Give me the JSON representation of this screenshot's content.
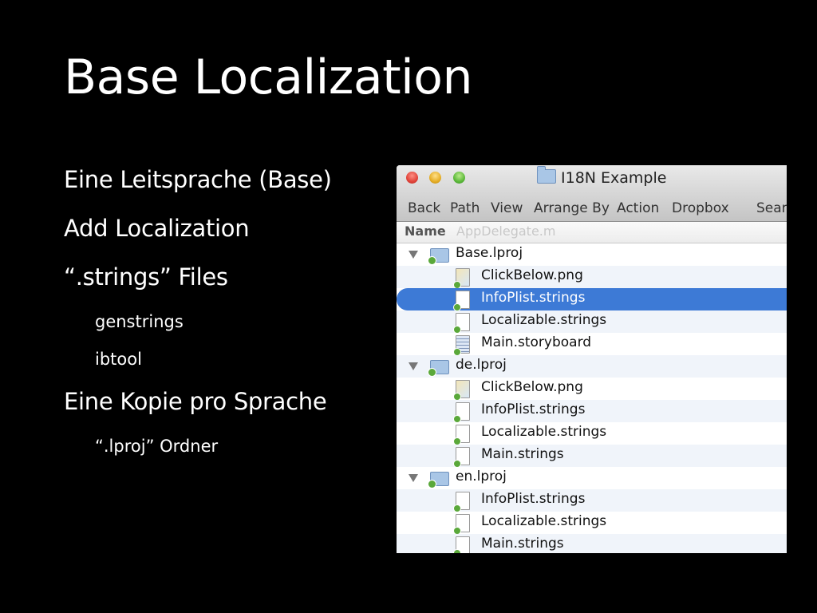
{
  "slide": {
    "title": "Base Localization",
    "bullets": [
      {
        "text": "Eine Leitsprache (Base)",
        "level": 1
      },
      {
        "text": "Add Localization",
        "level": 1
      },
      {
        "text": "“.strings” Files",
        "level": 1
      },
      {
        "text": "genstrings",
        "level": 2
      },
      {
        "text": "ibtool",
        "level": 2
      },
      {
        "text": "Eine Kopie pro Sprache",
        "level": 1
      },
      {
        "text": "“.lproj” Ordner",
        "level": 2
      }
    ]
  },
  "finder": {
    "window_title": "I18N Example",
    "toolbar": [
      "Back",
      "Path",
      "View",
      "Arrange By",
      "Action",
      "Dropbox",
      "Searc"
    ],
    "column_header": "Name",
    "column_header_faded": "AppDelegate.m",
    "rows": [
      {
        "label": "Base.lproj",
        "kind": "folder",
        "icon": "folder-icon"
      },
      {
        "label": "ClickBelow.png",
        "kind": "file",
        "icon": "image-file-icon"
      },
      {
        "label": "InfoPlist.strings",
        "kind": "file",
        "icon": "document-icon",
        "selected": true
      },
      {
        "label": "Localizable.strings",
        "kind": "file",
        "icon": "document-icon"
      },
      {
        "label": "Main.storyboard",
        "kind": "file",
        "icon": "storyboard-icon"
      },
      {
        "label": "de.lproj",
        "kind": "folder",
        "icon": "folder-icon"
      },
      {
        "label": "ClickBelow.png",
        "kind": "file",
        "icon": "image-file-icon"
      },
      {
        "label": "InfoPlist.strings",
        "kind": "file",
        "icon": "document-icon"
      },
      {
        "label": "Localizable.strings",
        "kind": "file",
        "icon": "document-icon"
      },
      {
        "label": "Main.strings",
        "kind": "file",
        "icon": "document-icon"
      },
      {
        "label": "en.lproj",
        "kind": "folder",
        "icon": "folder-icon"
      },
      {
        "label": "InfoPlist.strings",
        "kind": "file",
        "icon": "document-icon"
      },
      {
        "label": "Localizable.strings",
        "kind": "file",
        "icon": "document-icon"
      },
      {
        "label": "Main.strings",
        "kind": "file",
        "icon": "document-icon"
      }
    ],
    "colors": {
      "selection": "#3d7ad6",
      "alt_row": "#f0f4fa"
    }
  }
}
